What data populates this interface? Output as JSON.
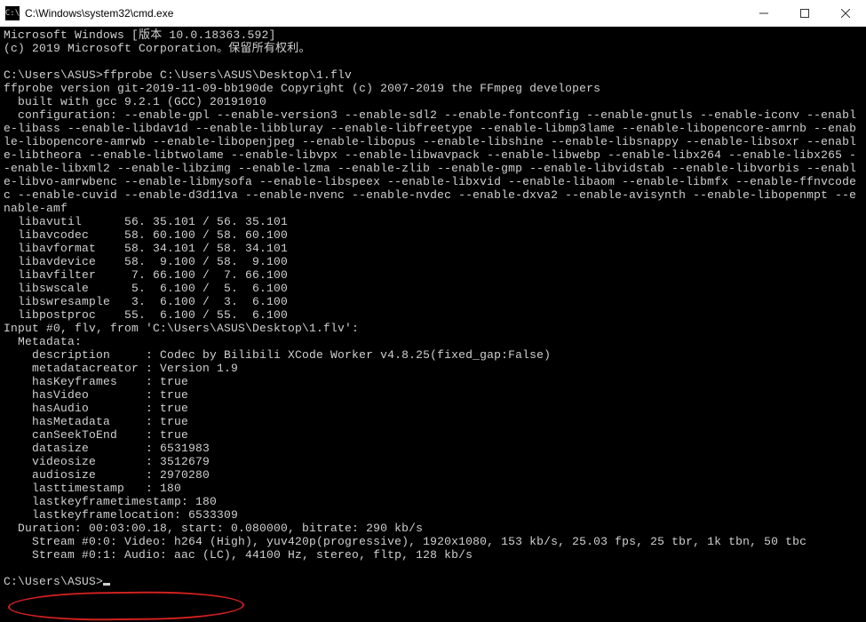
{
  "window": {
    "title": "C:\\Windows\\system32\\cmd.exe"
  },
  "lines": {
    "l0": "Microsoft Windows [版本 10.0.18363.592]",
    "l1": "(c) 2019 Microsoft Corporation。保留所有权利。",
    "l2": "",
    "l3": "C:\\Users\\ASUS>ffprobe C:\\Users\\ASUS\\Desktop\\1.flv",
    "l4": "ffprobe version git-2019-11-09-bb190de Copyright (c) 2007-2019 the FFmpeg developers",
    "l5": "  built with gcc 9.2.1 (GCC) 20191010",
    "l6": "  configuration: --enable-gpl --enable-version3 --enable-sdl2 --enable-fontconfig --enable-gnutls --enable-iconv --enabl",
    "l7": "e-libass --enable-libdav1d --enable-libbluray --enable-libfreetype --enable-libmp3lame --enable-libopencore-amrnb --enab",
    "l8": "le-libopencore-amrwb --enable-libopenjpeg --enable-libopus --enable-libshine --enable-libsnappy --enable-libsoxr --enabl",
    "l9": "e-libtheora --enable-libtwolame --enable-libvpx --enable-libwavpack --enable-libwebp --enable-libx264 --enable-libx265 -",
    "l10": "-enable-libxml2 --enable-libzimg --enable-lzma --enable-zlib --enable-gmp --enable-libvidstab --enable-libvorbis --enabl",
    "l11": "e-libvo-amrwbenc --enable-libmysofa --enable-libspeex --enable-libxvid --enable-libaom --enable-libmfx --enable-ffnvcode",
    "l12": "c --enable-cuvid --enable-d3d11va --enable-nvenc --enable-nvdec --enable-dxva2 --enable-avisynth --enable-libopenmpt --e",
    "l13": "nable-amf",
    "l14": "  libavutil      56. 35.101 / 56. 35.101",
    "l15": "  libavcodec     58. 60.100 / 58. 60.100",
    "l16": "  libavformat    58. 34.101 / 58. 34.101",
    "l17": "  libavdevice    58.  9.100 / 58.  9.100",
    "l18": "  libavfilter     7. 66.100 /  7. 66.100",
    "l19": "  libswscale      5.  6.100 /  5.  6.100",
    "l20": "  libswresample   3.  6.100 /  3.  6.100",
    "l21": "  libpostproc    55.  6.100 / 55.  6.100",
    "l22": "Input #0, flv, from 'C:\\Users\\ASUS\\Desktop\\1.flv':",
    "l23": "  Metadata:",
    "l24": "    description     : Codec by Bilibili XCode Worker v4.8.25(fixed_gap:False)",
    "l25": "    metadatacreator : Version 1.9",
    "l26": "    hasKeyframes    : true",
    "l27": "    hasVideo        : true",
    "l28": "    hasAudio        : true",
    "l29": "    hasMetadata     : true",
    "l30": "    canSeekToEnd    : true",
    "l31": "    datasize        : 6531983",
    "l32": "    videosize       : 3512679",
    "l33": "    audiosize       : 2970280",
    "l34": "    lasttimestamp   : 180",
    "l35": "    lastkeyframetimestamp: 180",
    "l36": "    lastkeyframelocation: 6533309",
    "l37": "  Duration: 00:03:00.18, start: 0.080000, bitrate: 290 kb/s",
    "l38": "    Stream #0:0: Video: h264 (High), yuv420p(progressive), 1920x1080, 153 kb/s, 25.03 fps, 25 tbr, 1k tbn, 50 tbc",
    "l39": "    Stream #0:1: Audio: aac (LC), 44100 Hz, stereo, fltp, 128 kb/s",
    "l40": "",
    "l41": "C:\\Users\\ASUS>"
  }
}
